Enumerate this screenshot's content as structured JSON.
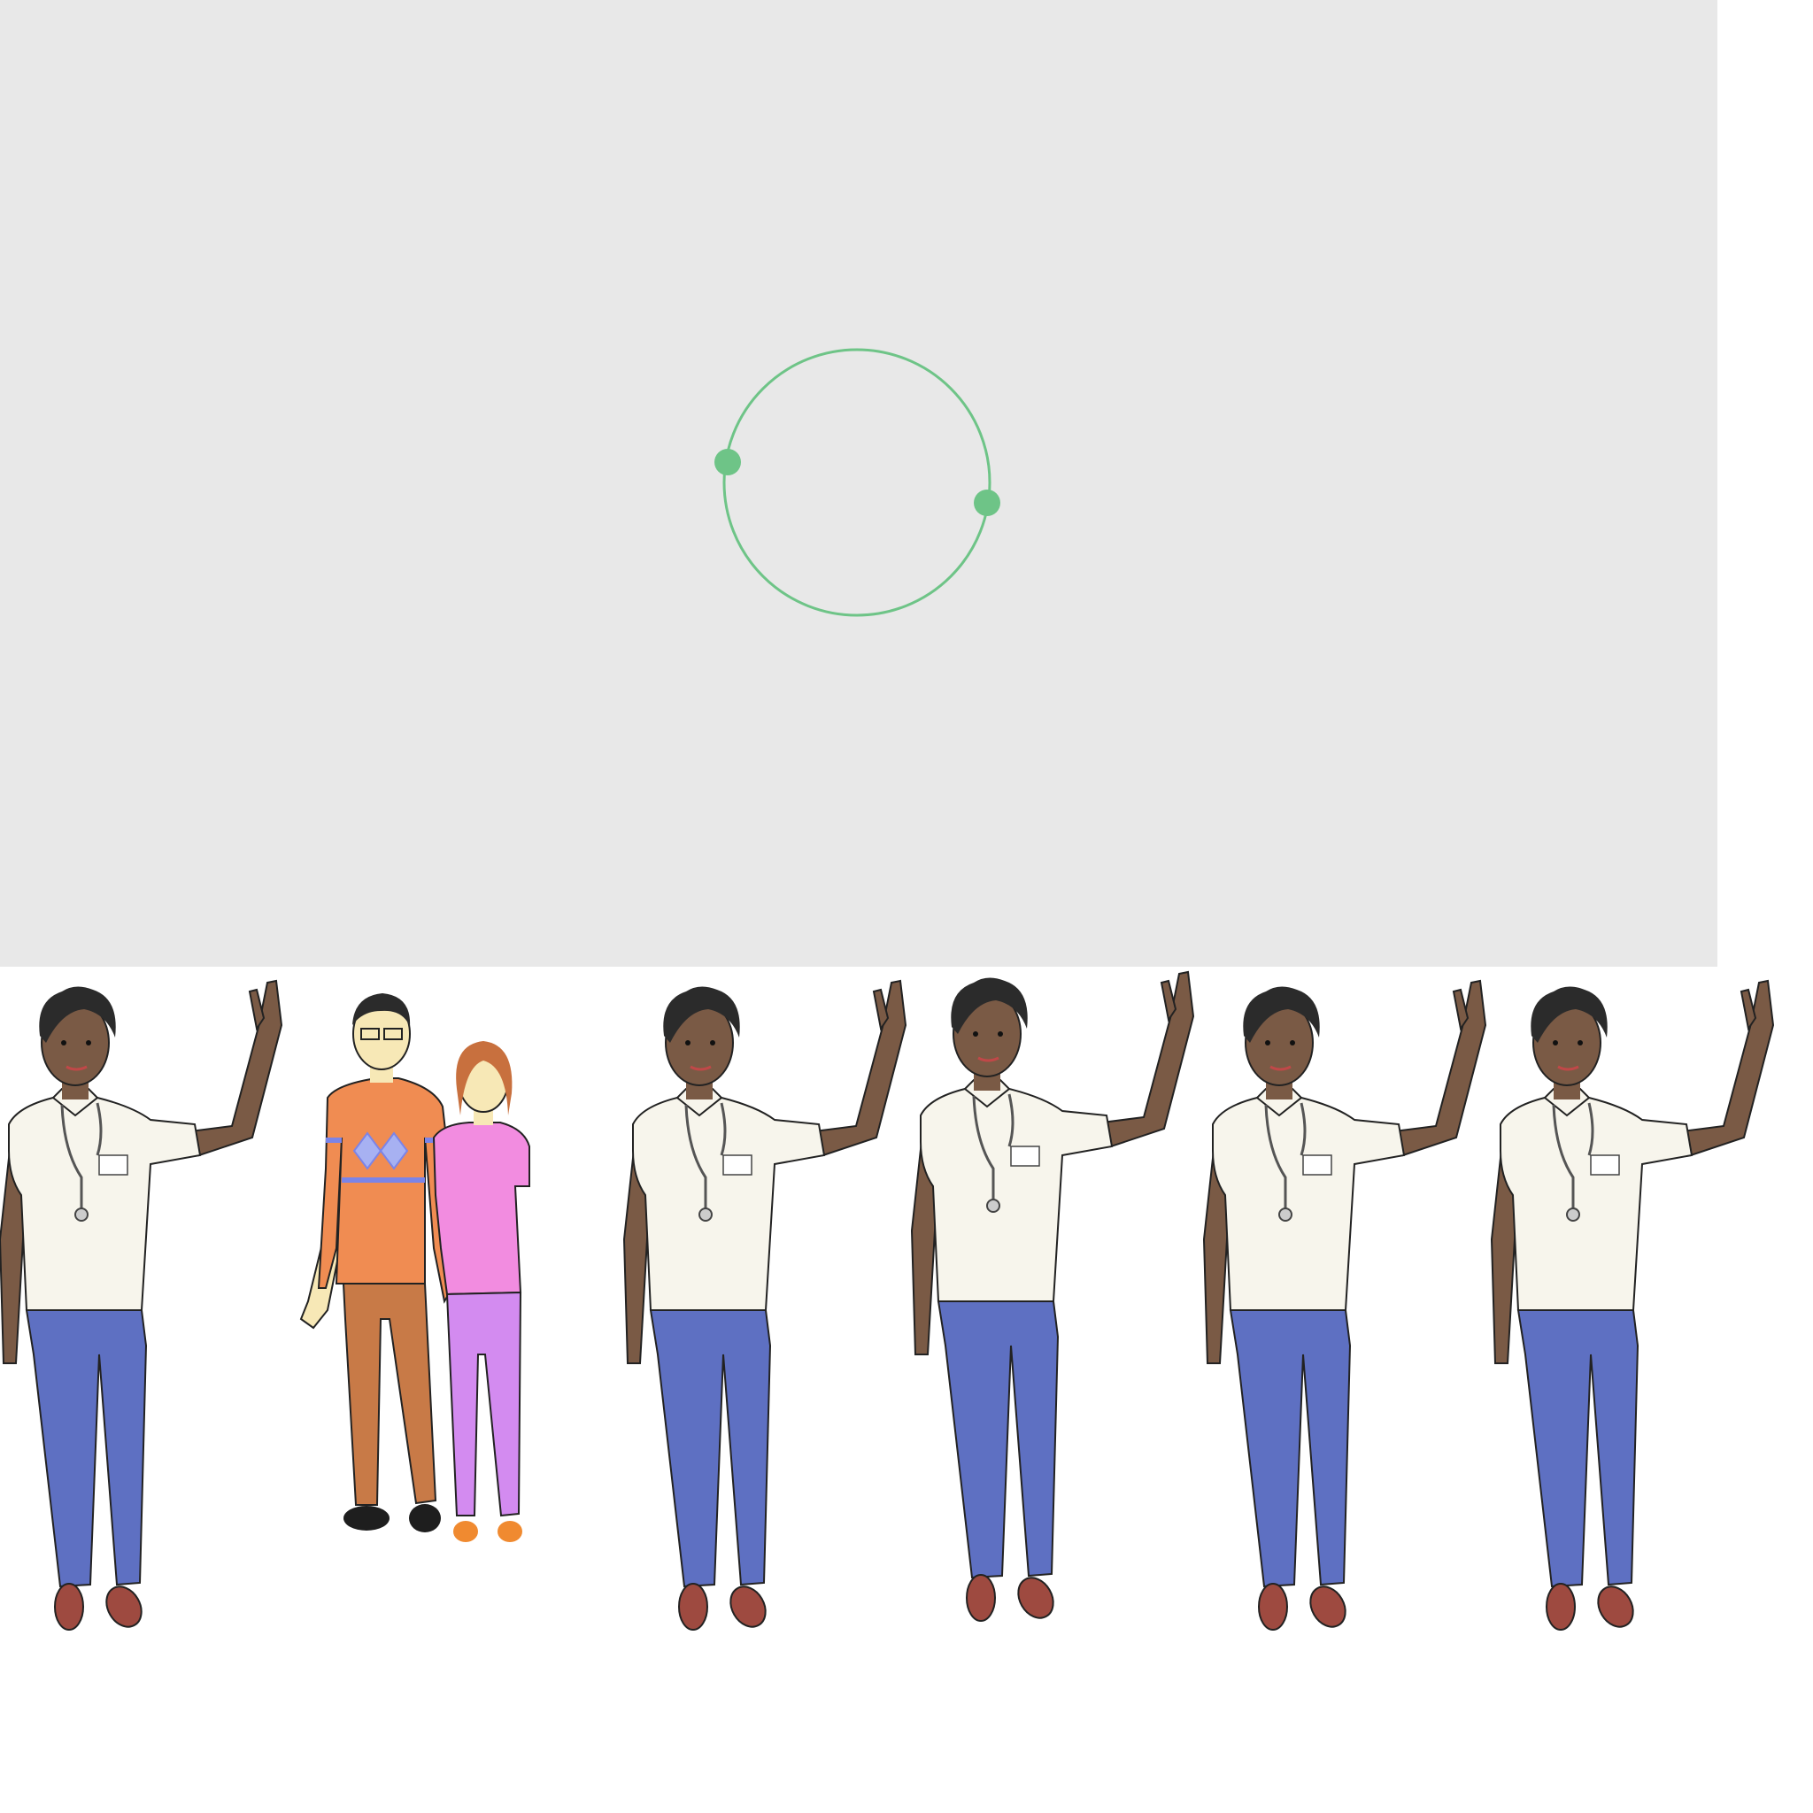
{
  "stage": {
    "background": "#e8e8e8",
    "loading_indicator": {
      "icon": "loading-ring-icon",
      "color": "#6ec487",
      "handles": 2
    }
  },
  "figures": [
    {
      "name": "nurse-waving",
      "icon": "nurse-figure"
    },
    {
      "name": "couple",
      "icon": "couple-figure"
    },
    {
      "name": "nurse-waving",
      "icon": "nurse-figure"
    },
    {
      "name": "nurse-waving",
      "icon": "nurse-figure"
    },
    {
      "name": "nurse-waving",
      "icon": "nurse-figure"
    },
    {
      "name": "nurse-waving",
      "icon": "nurse-figure"
    }
  ],
  "colors": {
    "skin_dark": "#7a5a45",
    "hair": "#2b2b2b",
    "shirt": "#f7f5ec",
    "pants": "#5e70c2",
    "shoes": "#9e4a40",
    "sweater": "#f08c52",
    "sweater_stripe": "#7b84e8",
    "slacks": "#c87a47",
    "top_pink": "#f28ce0",
    "pants_lilac": "#d38bf0",
    "skin_light": "#f7e8b6",
    "hair_red": "#c8703e"
  }
}
